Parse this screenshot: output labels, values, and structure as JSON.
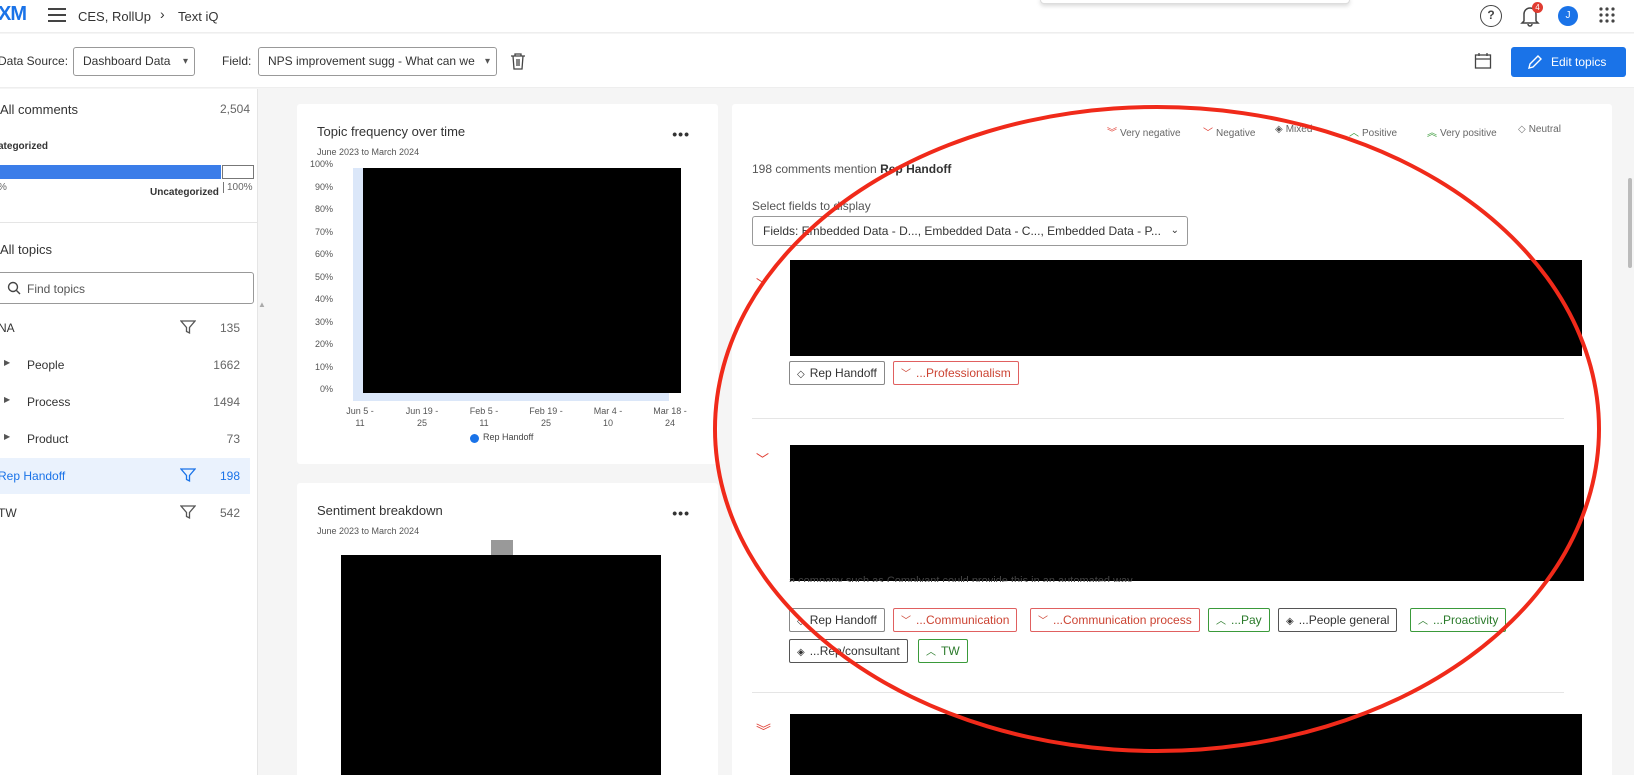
{
  "header": {
    "logo": "XM",
    "breadcrumb_project": "CES, RollUp",
    "breadcrumb_separator": "›",
    "breadcrumb_page": "Text iQ",
    "help_icon_text": "?",
    "notification_count": "4",
    "avatar_initial": "J"
  },
  "toolbar": {
    "data_source_label": "Data Source:",
    "data_source_value": "Dashboard Data",
    "field_label": "Field:",
    "field_value": "NPS improvement sugg - What can we",
    "edit_topics_label": "Edit topics"
  },
  "sidebar": {
    "all_comments_label": "All comments",
    "all_comments_count": "2,504",
    "categorized_label": "ategorized",
    "categorized_fraction": 0.87,
    "bar_min_label": "%",
    "bar_max_label": "100%",
    "uncategorized_label": "Uncategorized",
    "all_topics_label": "All topics",
    "search_placeholder": "Find topics",
    "topics": [
      {
        "name": "NA",
        "count": "135"
      },
      {
        "name": "People",
        "count": "1662"
      },
      {
        "name": "Process",
        "count": "1494"
      },
      {
        "name": "Product",
        "count": "73"
      },
      {
        "name": "Rep Handoff",
        "count": "198"
      },
      {
        "name": "TW",
        "count": "542"
      }
    ]
  },
  "topic_frequency": {
    "title": "Topic frequency over time",
    "subtitle": "June 2023 to March 2024",
    "more": "•••",
    "legend": "Rep Handoff",
    "chart_data": {
      "type": "line",
      "title": "Topic frequency over time",
      "subtitle": "June 2023 to March 2024",
      "y_ticks": [
        "100%",
        "90%",
        "80%",
        "70%",
        "60%",
        "50%",
        "40%",
        "30%",
        "20%",
        "10%",
        "0%"
      ],
      "x_ticks": [
        {
          "line1": "Jun 5 -",
          "line2": "11"
        },
        {
          "line1": "Jun 19 -",
          "line2": "25"
        },
        {
          "line1": "Feb 5 -",
          "line2": "11"
        },
        {
          "line1": "Feb 19 -",
          "line2": "25"
        },
        {
          "line1": "Mar 4 -",
          "line2": "10"
        },
        {
          "line1": "Mar 18 -",
          "line2": "24"
        }
      ],
      "series": [
        {
          "name": "Rep Handoff",
          "values": []
        }
      ]
    }
  },
  "sentiment_breakdown": {
    "title": "Sentiment breakdown",
    "subtitle": "June 2023 to March 2024",
    "more": "•••"
  },
  "comments_panel": {
    "legend": [
      {
        "glyph": "︾",
        "label": "Very negative",
        "color": "#e03c31"
      },
      {
        "glyph": "﹀",
        "label": "Negative",
        "color": "#e03c31"
      },
      {
        "glyph": "◈",
        "label": "Mixed",
        "color": "#555555"
      },
      {
        "glyph": "︿",
        "label": "Positive",
        "color": "#3a9a3a"
      },
      {
        "glyph": "︽",
        "label": "Very positive",
        "color": "#3a9a3a"
      },
      {
        "glyph": "◇",
        "label": "Neutral",
        "color": "#777777"
      }
    ],
    "mention_prefix": "198 comments mention",
    "mention_topic": "Rep Handoff",
    "select_fields_label": "Select fields to display",
    "fields_value": "Fields: Embedded Data - D..., Embedded Data - C..., Embedded Data - P...",
    "comment1_tags": [
      {
        "glyph": "◇",
        "label": "Rep Handoff",
        "kind": "neutral"
      },
      {
        "glyph": "﹀",
        "label": "...Professionalism",
        "kind": "neg"
      }
    ],
    "comment2_tags": [
      {
        "glyph": "◇",
        "label": "Rep Handoff",
        "kind": "neutral"
      },
      {
        "glyph": "﹀",
        "label": "...Communication",
        "kind": "neg"
      },
      {
        "glyph": "﹀",
        "label": "...Communication process",
        "kind": "neg"
      },
      {
        "glyph": "︿",
        "label": "...Pay",
        "kind": "pos"
      },
      {
        "glyph": "◈",
        "label": "...People general",
        "kind": "mix"
      },
      {
        "glyph": "︿",
        "label": "...Proactivity",
        "kind": "pos"
      },
      {
        "glyph": "◈",
        "label": "...Rep/consultant",
        "kind": "mix"
      },
      {
        "glyph": "︿",
        "label": "TW",
        "kind": "pos"
      }
    ],
    "comment2_leak_text": "a company such as Complyant could provide this in an automated way."
  }
}
